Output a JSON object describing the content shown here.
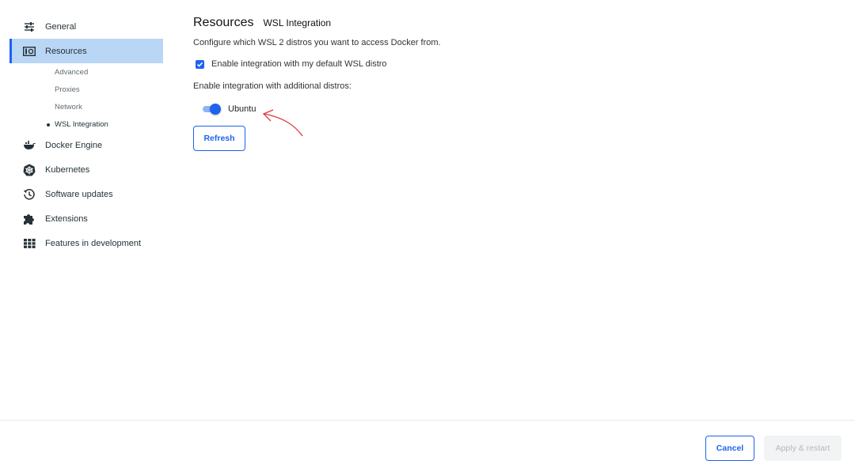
{
  "sidebar": {
    "items": [
      {
        "label": "General"
      },
      {
        "label": "Resources"
      },
      {
        "label": "Docker Engine"
      },
      {
        "label": "Kubernetes"
      },
      {
        "label": "Software updates"
      },
      {
        "label": "Extensions"
      },
      {
        "label": "Features in development"
      }
    ],
    "resources_sub": [
      {
        "label": "Advanced"
      },
      {
        "label": "Proxies"
      },
      {
        "label": "Network"
      },
      {
        "label": "WSL Integration"
      }
    ]
  },
  "main": {
    "title": "Resources",
    "subtitle": "WSL Integration",
    "description": "Configure which WSL 2 distros you want to access Docker from.",
    "default_distro_checkbox": {
      "label": "Enable integration with my default WSL distro",
      "checked": true
    },
    "additional_label": "Enable integration with additional distros:",
    "distros": [
      {
        "name": "Ubuntu",
        "enabled": true
      }
    ],
    "refresh_label": "Refresh"
  },
  "footer": {
    "cancel_label": "Cancel",
    "apply_label": "Apply & restart"
  },
  "colors": {
    "accent": "#1d63ed",
    "active_nav_bg": "#b9d6f5",
    "annotation": "#e0383e"
  }
}
